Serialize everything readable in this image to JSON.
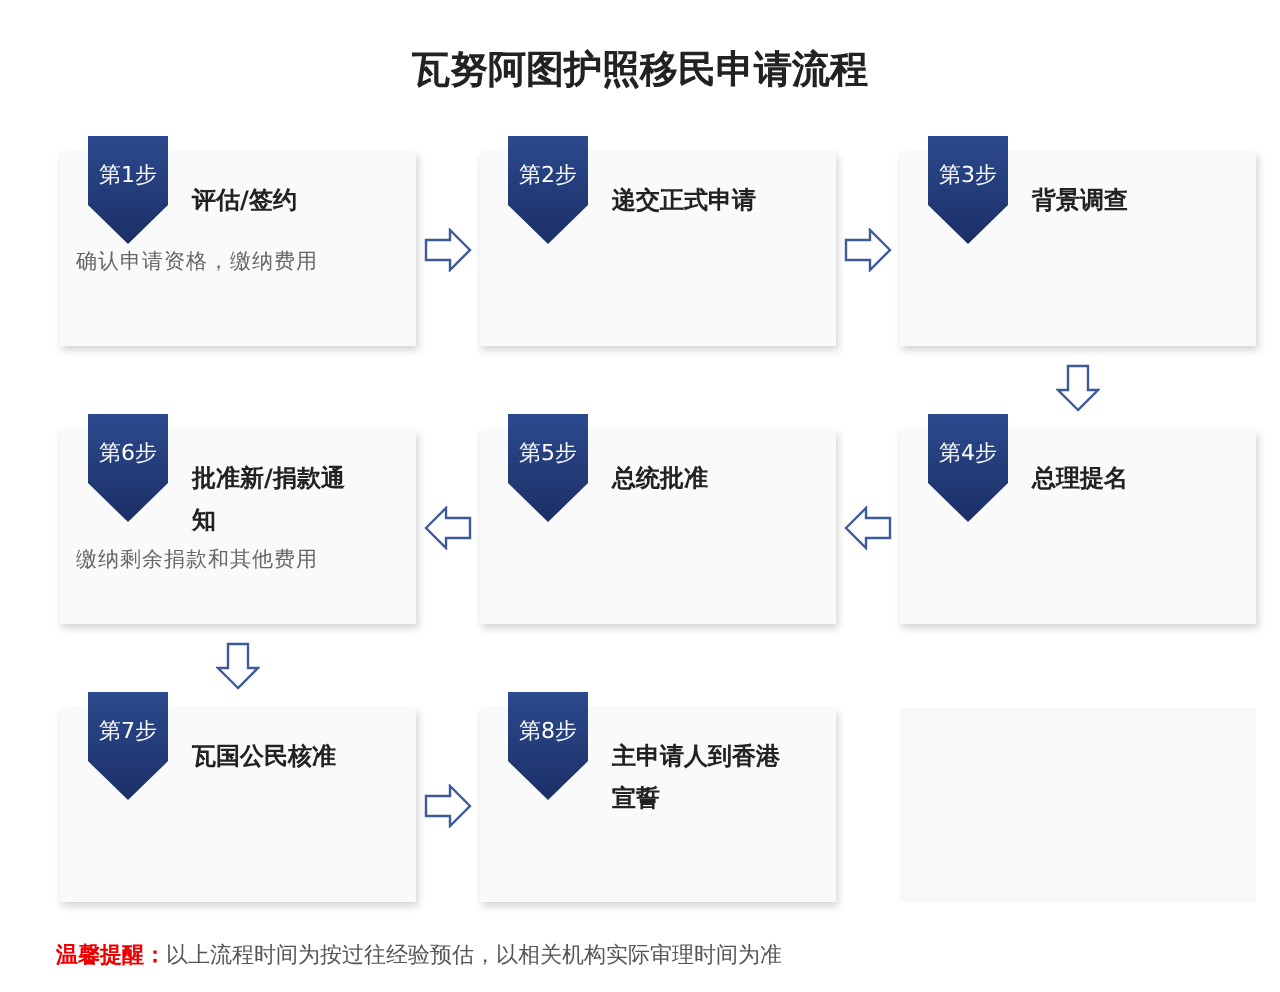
{
  "title": "瓦努阿图护照移民申请流程",
  "rows": [
    {
      "kind": "rightward",
      "steps": [
        {
          "kind": "step",
          "badge": "第1步",
          "title": "评估/签约",
          "description": "确认申请资格，缴纳费用"
        },
        {
          "kind": "step",
          "badge": "第2步",
          "title": "递交正式申请"
        },
        {
          "kind": "step",
          "badge": "第3步",
          "title": "背景调查"
        }
      ]
    },
    {
      "kind": "leftward",
      "steps": [
        {
          "kind": "step",
          "badge": "第6步",
          "title": "批准新/捐款通知",
          "description": "缴纳剩余捐款和其他费用"
        },
        {
          "kind": "step",
          "badge": "第5步",
          "title": "总统批准"
        },
        {
          "kind": "step",
          "badge": "第4步",
          "title": "总理提名"
        }
      ]
    },
    {
      "kind": "rightward",
      "steps": [
        {
          "kind": "step",
          "badge": "第7步",
          "title": "瓦国公民核准"
        },
        {
          "kind": "step",
          "badge": "第8步",
          "title": "主申请人到香港宣誓"
        },
        {
          "kind": "empty"
        }
      ]
    }
  ],
  "footer": {
    "label": "温馨提醒：",
    "text": "以上流程时间为按过往经验预估，以相关机构实际审理时间为准"
  }
}
